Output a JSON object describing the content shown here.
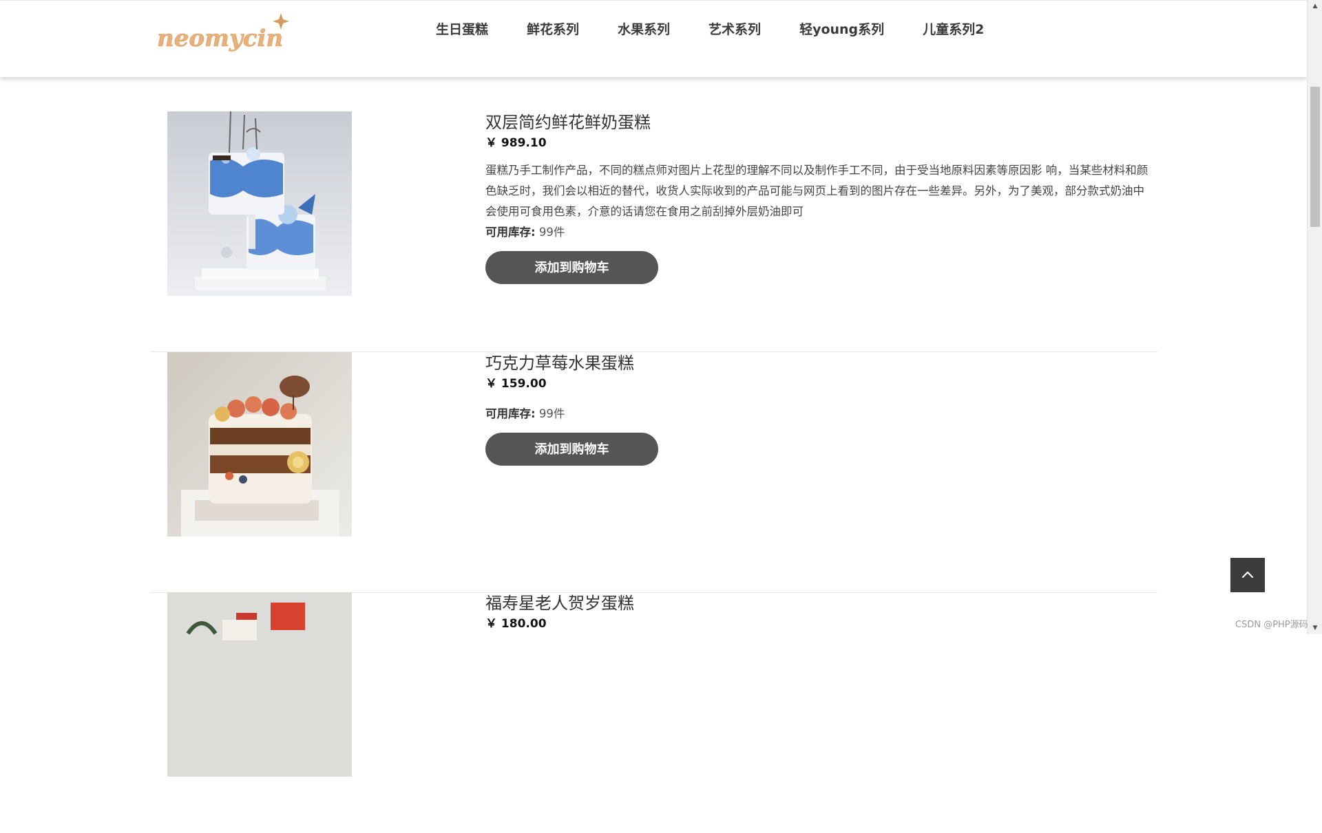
{
  "header": {
    "logo_text": "neomycin",
    "nav_items": [
      "生日蛋糕",
      "鲜花系列",
      "水果系列",
      "艺术系列",
      "轻young系列",
      "儿童系列2"
    ]
  },
  "products": [
    {
      "title": "双层简约鲜花鲜奶蛋糕",
      "price": "￥ 989.10",
      "description": "蛋糕乃手工制作产品，不同的糕点师对图片上花型的理解不同以及制作手工不同，由于受当地原料因素等原因影 响，当某些材料和颜色缺乏时，我们会以相近的替代，收货人实际收到的产品可能与网页上看到的图片存在一些差异。另外，为了美观，部分款式奶油中会使用可食用色素，介意的话请您在食用之前刮掉外层奶油即可",
      "stock_label": "可用库存:",
      "stock_value": "99件",
      "button_label": "添加到购物车",
      "image_name": "blue-two-tier-cake"
    },
    {
      "title": "巧克力草莓水果蛋糕",
      "price": "￥ 159.00",
      "description": "",
      "stock_label": "可用库存:",
      "stock_value": "99件",
      "button_label": "添加到购物车",
      "image_name": "chocolate-strawberry-cake"
    },
    {
      "title": "福寿星老人贺岁蛋糕",
      "price": "￥ 180.00",
      "image_name": "longevity-cake"
    }
  ],
  "back_to_top_icon": "chevron-up-icon",
  "watermark": "CSDN @PHP源码",
  "colors": {
    "button_bg": "#555555",
    "back_top_bg": "#3c3c3c",
    "logo": "#e2a86a"
  }
}
